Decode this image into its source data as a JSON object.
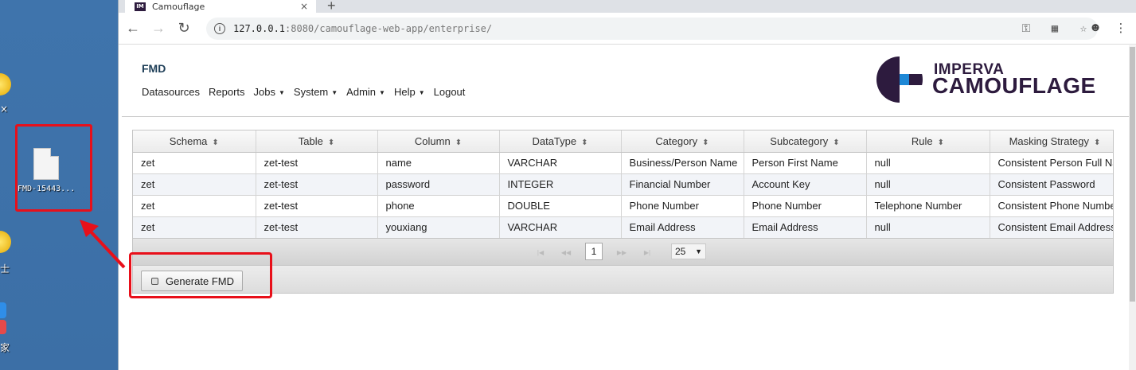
{
  "desktop": {
    "fragments": [
      "×",
      "士",
      "家"
    ],
    "file_label": "FMD-15443..."
  },
  "browser": {
    "tab_title": "Camouflage",
    "tab_favicon": "IM",
    "tab_close": "×",
    "new_tab": "+",
    "url_host": "127.0.0.1",
    "url_path": ":8080/camouflage-web-app/enterprise/",
    "info_icon": "i"
  },
  "app": {
    "title": "FMD",
    "menu": [
      {
        "label": "Datasources",
        "caret": ""
      },
      {
        "label": "Reports",
        "caret": ""
      },
      {
        "label": "Jobs",
        "caret": "▼"
      },
      {
        "label": "System",
        "caret": "▼"
      },
      {
        "label": "Admin",
        "caret": "▼"
      },
      {
        "label": "Help",
        "caret": "▼"
      },
      {
        "label": "Logout",
        "caret": ""
      }
    ],
    "logo_line1": "IMPERVA",
    "logo_line2": "CAMOUFLAGE",
    "brand_color": "#2d1b3e",
    "logo_accent": "#1e88d6"
  },
  "table": {
    "sort_icon": "⬍",
    "columns": [
      "Schema",
      "Table",
      "Column",
      "DataType",
      "Category",
      "Subcategory",
      "Rule",
      "Masking Strategy"
    ],
    "rows": [
      [
        "zet",
        "zet-test",
        "name",
        "VARCHAR",
        "Business/Person Name",
        "Person First Name",
        "null",
        "Consistent Person Full Name"
      ],
      [
        "zet",
        "zet-test",
        "password",
        "INTEGER",
        "Financial Number",
        "Account Key",
        "null",
        "Consistent Password"
      ],
      [
        "zet",
        "zet-test",
        "phone",
        "DOUBLE",
        "Phone Number",
        "Phone Number",
        "Telephone Number",
        "Consistent Phone Number"
      ],
      [
        "zet",
        "zet-test",
        "youxiang",
        "VARCHAR",
        "Email Address",
        "Email Address",
        "null",
        "Consistent Email Address"
      ]
    ]
  },
  "paginator": {
    "first": "|◀",
    "prev": "◀◀",
    "page": "1",
    "next": "▶▶",
    "last": "▶|",
    "page_size": "25",
    "dropdown_arrow": "▼"
  },
  "actions": {
    "generate_label": "Generate FMD"
  },
  "annotation_color": "#e8101a"
}
